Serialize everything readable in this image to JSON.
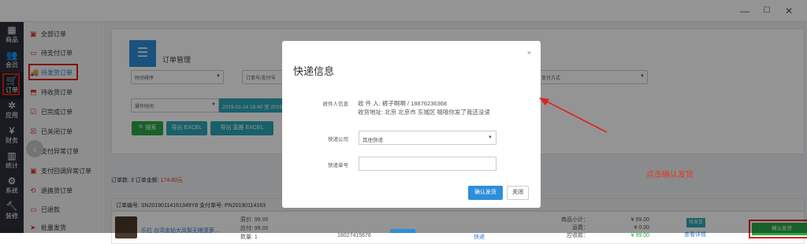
{
  "window": {
    "minimize": "—",
    "maximize": "☐",
    "close": "✕"
  },
  "leftbar": [
    {
      "label": "商品",
      "icon": "▦"
    },
    {
      "label": "会员",
      "icon": "👥"
    },
    {
      "label": "订单",
      "icon": "🛒"
    },
    {
      "label": "应用",
      "icon": "✲"
    },
    {
      "label": "财务",
      "icon": "¥"
    },
    {
      "label": "统计",
      "icon": "▥"
    },
    {
      "label": "系统",
      "icon": "⚙"
    },
    {
      "label": "装修",
      "icon": "🔨"
    }
  ],
  "sidebar": [
    {
      "label": "全部订单",
      "icon": "▣"
    },
    {
      "label": "待支付订单",
      "icon": "▭"
    },
    {
      "label": "待发货订单",
      "icon": "🚚"
    },
    {
      "label": "待收货订单",
      "icon": "⬒"
    },
    {
      "label": "已完成订单",
      "icon": "☑"
    },
    {
      "label": "已关闭订单",
      "icon": "☒"
    },
    {
      "label": "支付异常订单",
      "icon": "▣"
    },
    {
      "label": "支付回调异常订单",
      "icon": "▣"
    },
    {
      "label": "退换货订单",
      "icon": "⟲"
    },
    {
      "label": "已退款",
      "icon": "▭"
    },
    {
      "label": "批量发货",
      "icon": "➤"
    }
  ],
  "panel": {
    "title": "订单管理",
    "time_sort": "时间排序",
    "order_no": "订单号/支付号",
    "pay_method": "支付方式",
    "op_time": "操作时间",
    "date_range": "2019-01-14 16:40 至 2019-0",
    "search_btn": "搜索",
    "export_btn": "导出 EXCEL",
    "export_detail_btn": "导出 直推 EXCEL"
  },
  "summary": {
    "count_label": "订单数: 3 订单金额: ",
    "amount": "174.60元"
  },
  "order": {
    "header": "订单编号: SN20190114161349Y8 支付单号: PN20190114163",
    "product": "乐拉 台湾金钻大凤梨无眼菠萝…",
    "prices": [
      "原价: 99.00",
      "应付: 99.00",
      "数量: 1"
    ],
    "phone": "18027415676",
    "ship": "快递",
    "sum_labels": [
      "商品小计：",
      "运费：",
      "应收款："
    ],
    "sum_values": [
      "¥ 99.00",
      "¥ 0.00",
      "¥ 99.00"
    ],
    "status": "待发货",
    "detail": "查看详情",
    "confirm": "确认发货"
  },
  "annotation": "点击确认发货",
  "modal": {
    "title": "快递信息",
    "close": "×",
    "recipient_label": "收件人信息",
    "recipient_name": "收 件 人: 裤子啊啊 / 18876236368",
    "recipient_addr": "收货地址: 北京 北京市 东城区 嘻嘻你发了我还没读",
    "courier_label": "快递公司",
    "courier_value": "其他快递",
    "tracking_label": "快递单号",
    "confirm": "确认发货",
    "cancel": "关闭"
  }
}
